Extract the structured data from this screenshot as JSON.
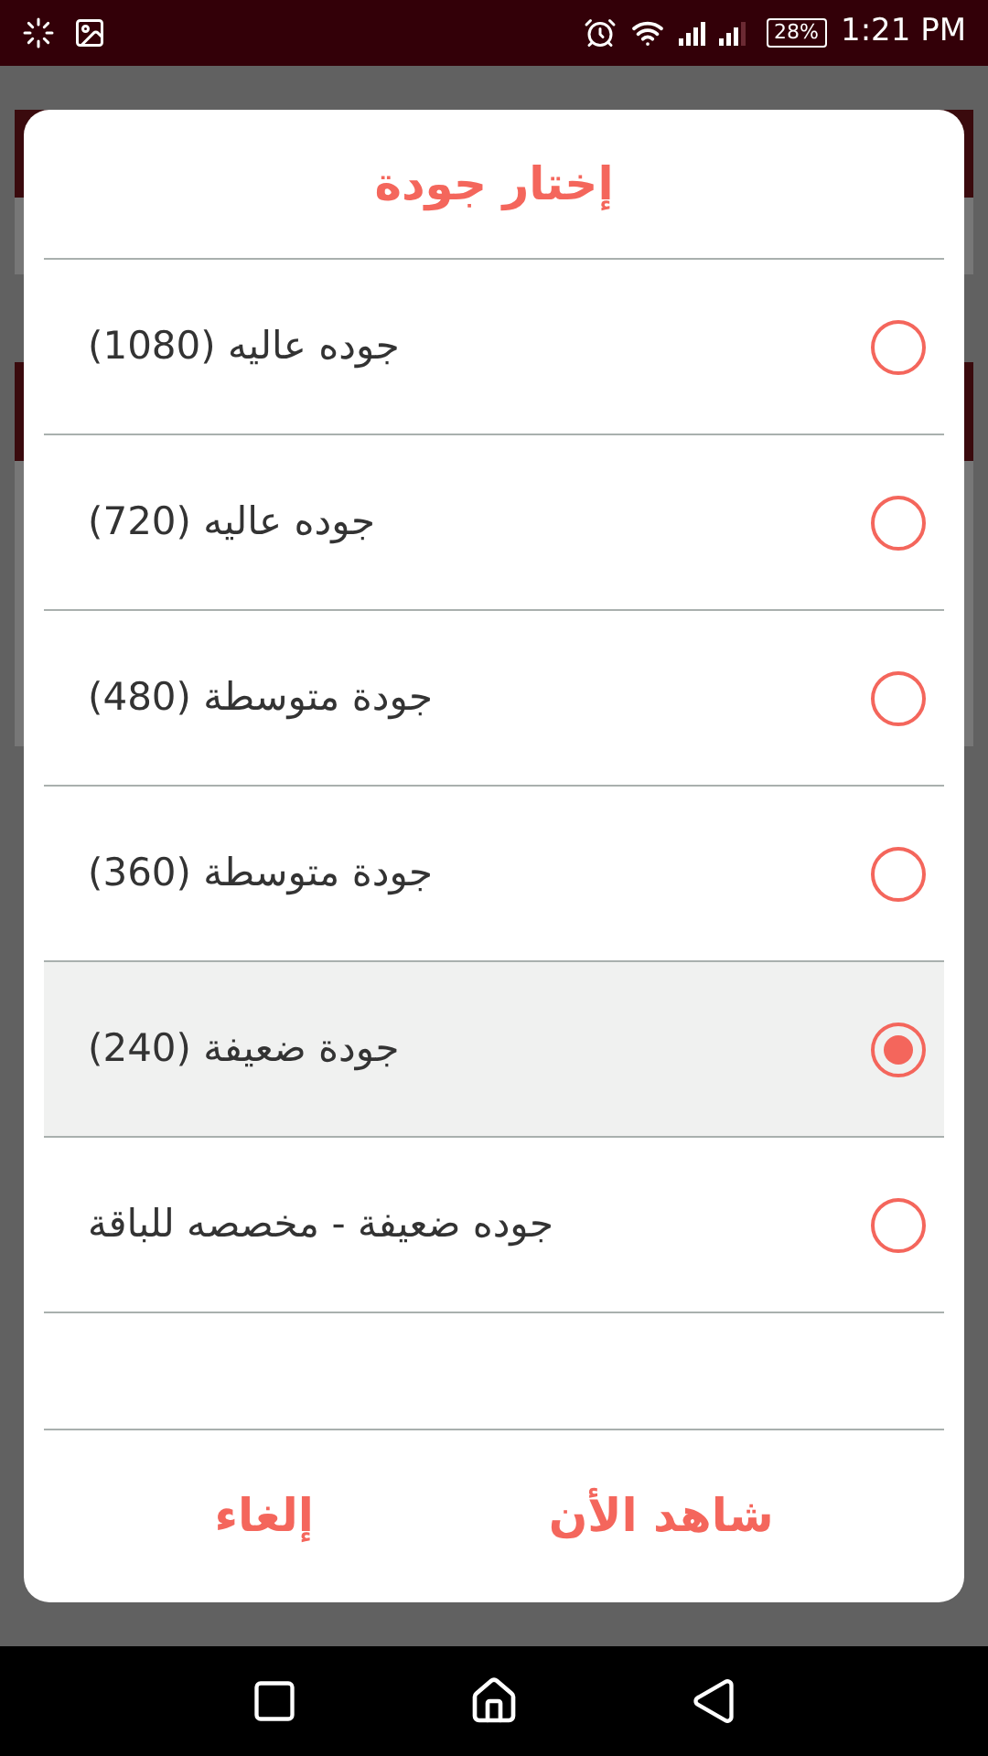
{
  "status_bar": {
    "battery": "28%",
    "time": "1:21 PM"
  },
  "dialog": {
    "title": "إختار جودة",
    "options": [
      {
        "label": "جوده عاليه (1080)",
        "selected": false
      },
      {
        "label": "جوده عاليه (720)",
        "selected": false
      },
      {
        "label": "جودة متوسطة (480)",
        "selected": false
      },
      {
        "label": "جودة متوسطة (360)",
        "selected": false
      },
      {
        "label": "جودة ضعيفة (240)",
        "selected": true
      },
      {
        "label": "جوده ضعيفة - مخصصه للباقة",
        "selected": false
      }
    ],
    "buttons": [
      {
        "label": "شاهد الأن"
      },
      {
        "label": "إلغاء"
      }
    ]
  }
}
